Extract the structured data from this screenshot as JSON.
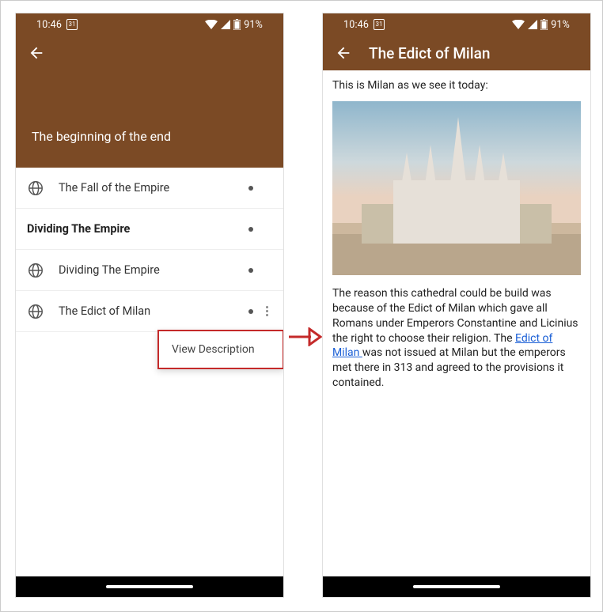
{
  "status": {
    "time": "10:46",
    "date_badge": "31",
    "battery_pct": "91%"
  },
  "left": {
    "section_title": "The beginning of the end",
    "rows": [
      {
        "label": "The Fall of the Empire",
        "icon": true,
        "heading": false,
        "more": false
      },
      {
        "label": "Dividing The Empire",
        "icon": false,
        "heading": true,
        "more": false
      },
      {
        "label": "Dividing The Empire",
        "icon": true,
        "heading": false,
        "more": false
      },
      {
        "label": "The Edict of Milan",
        "icon": true,
        "heading": false,
        "more": true
      }
    ],
    "popup_label": "View Description"
  },
  "right": {
    "title": "The Edict of Milan",
    "intro": "This is Milan as we see it today:",
    "body_pre": "The reason this cathedral could be build was because of the Edict of Milan which gave all Romans under Emperors Constantine and Licinius the right to choose their religion. The ",
    "link_text": "Edict of Milan ",
    "body_post": "was not issued at Milan but the emperors met there in 313 and agreed to the provisions it contained."
  }
}
